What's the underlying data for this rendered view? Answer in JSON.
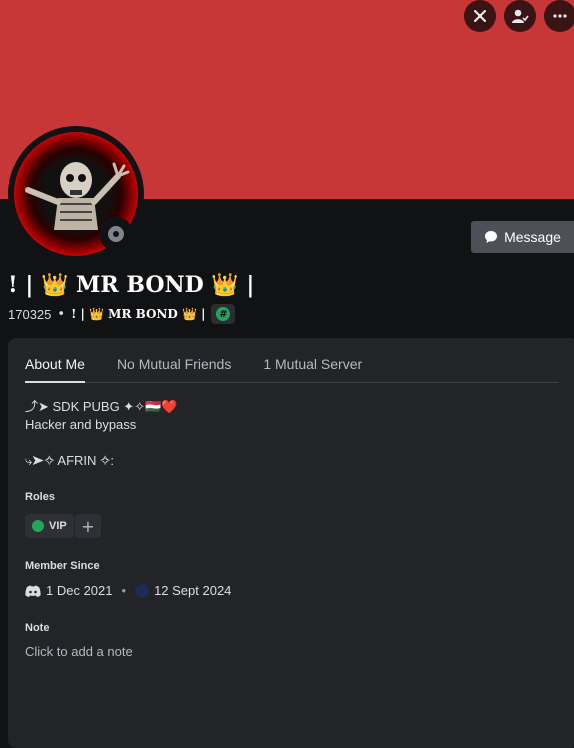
{
  "actions": {
    "icon1": "sword-cross-icon",
    "icon2": "add-friend-icon",
    "icon3": "more-options-icon"
  },
  "profile": {
    "display_name": "! | 👑 MR BOND 👑 |",
    "username": "170325",
    "separator": "•",
    "global_name": "! | 👑 MR BOND 👑 |",
    "badge_symbol": "#",
    "message_label": "Message"
  },
  "tabs": [
    "About Me",
    "No Mutual Friends",
    "1 Mutual Server"
  ],
  "about": {
    "line1": "⤴➤ SDK PUBG ✦✧🇭🇺❤️",
    "line2": "Hacker and bypass",
    "line3": "⤷➤✧  AFRIN ✧:"
  },
  "roles": {
    "title": "Roles",
    "items": [
      {
        "name": "VIP",
        "color": "#23a55a"
      }
    ],
    "add_symbol": "+"
  },
  "member_since": {
    "title": "Member Since",
    "discord_date": "1 Dec 2021",
    "separator": "•",
    "server_date": "12 Sept 2024"
  },
  "note": {
    "title": "Note",
    "placeholder": "Click to add a note"
  },
  "colors": {
    "banner": "#c83737",
    "background": "#111214",
    "card": "#232428"
  }
}
